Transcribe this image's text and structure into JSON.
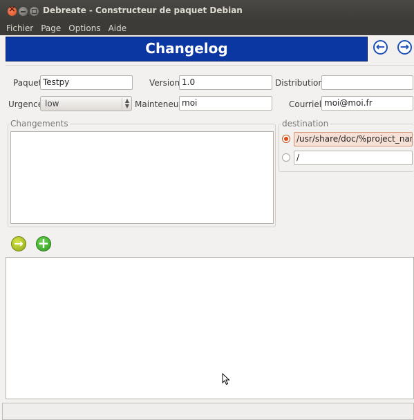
{
  "window": {
    "title": "Debreate - Constructeur de paquet Debian"
  },
  "menubar": {
    "items": [
      "Fichier",
      "Page",
      "Options",
      "Aide"
    ]
  },
  "header": {
    "title": "Changelog"
  },
  "form": {
    "package_label": "Paquet",
    "package_value": "Testpy",
    "version_label": "Version",
    "version_value": "1.0",
    "distribution_label": "Distribution",
    "distribution_value": "",
    "urgency_label": "Urgence",
    "urgency_value": "low",
    "maintainer_label": "Mainteneur",
    "maintainer_value": "moi",
    "email_label": "Courriel",
    "email_value": "moi@moi.fr"
  },
  "changes": {
    "label": "Changements",
    "text": ""
  },
  "destination": {
    "label": "destination",
    "option1": "/usr/share/doc/%project_name%",
    "option2": "/"
  },
  "icons": {
    "nav_prev": "arrow-left-circle",
    "nav_next": "arrow-right-circle",
    "import": "arrow-right-circle-green",
    "add": "plus-circle-green"
  }
}
